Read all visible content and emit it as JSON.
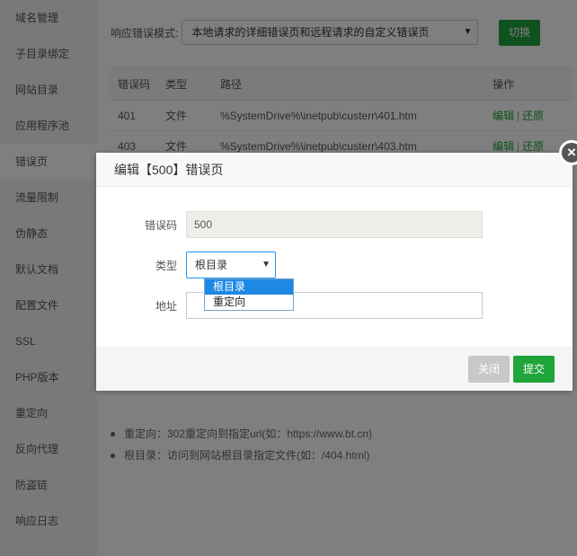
{
  "sidebar": {
    "items": [
      {
        "label": "域名管理"
      },
      {
        "label": "子目录绑定"
      },
      {
        "label": "网站目录"
      },
      {
        "label": "应用程序池"
      },
      {
        "label": "错误页"
      },
      {
        "label": "流量限制"
      },
      {
        "label": "伪静态"
      },
      {
        "label": "默认文档"
      },
      {
        "label": "配置文件"
      },
      {
        "label": "SSL"
      },
      {
        "label": "PHP版本"
      },
      {
        "label": "重定向"
      },
      {
        "label": "反向代理"
      },
      {
        "label": "防盗链"
      },
      {
        "label": "响应日志"
      }
    ],
    "active_index": 4
  },
  "main": {
    "mode_label": "响应错误模式:",
    "mode_value": "本地请求的详细错误页和远程请求的自定义错误页",
    "switch_label": "切换",
    "table": {
      "headers": [
        "错误码",
        "类型",
        "路径",
        "操作"
      ],
      "rows": [
        {
          "code": "401",
          "type": "文件",
          "path": "%SystemDrive%\\inetpub\\custerr\\401.htm",
          "edit": "编辑",
          "sep": "|",
          "restore": "还原"
        },
        {
          "code": "403",
          "type": "文件",
          "path": "%SystemDrive%\\inetpub\\custerr\\403.htm",
          "edit": "编辑",
          "sep": "|",
          "restore": "还原"
        }
      ]
    },
    "tips": [
      "重定向：302重定向到指定url(如：https://www.bt.cn)",
      "根目录：访问到网站根目录指定文件(如：/404.html)"
    ]
  },
  "modal": {
    "title": "编辑【500】错误页",
    "code_label": "错误码",
    "code_value": "500",
    "type_label": "类型",
    "type_value": "根目录",
    "type_options": [
      "根目录",
      "重定向"
    ],
    "address_label": "地址",
    "address_value": "",
    "close_label": "关闭",
    "submit_label": "提交",
    "close_icon": "×"
  },
  "colors": {
    "accent": "#20a53a",
    "select_highlight": "#1e88e5"
  }
}
